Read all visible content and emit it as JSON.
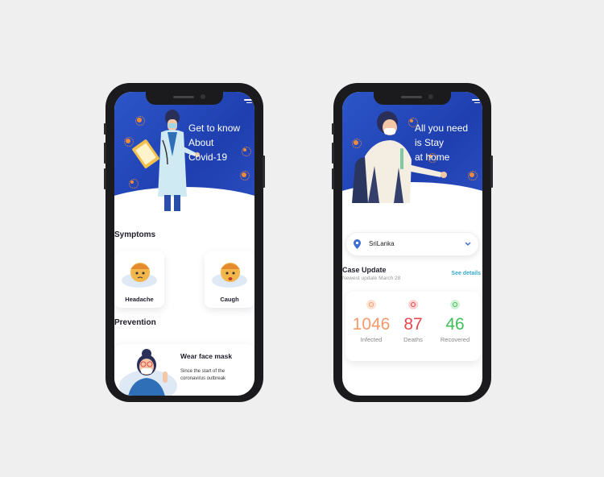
{
  "left_phone": {
    "hero_title": "Get to know\nAbout\nCovid-19",
    "symptoms_title": "Symptoms",
    "symptoms": [
      {
        "label": "Headache"
      },
      {
        "label": "Caugh"
      }
    ],
    "prevention_title": "Prevention",
    "prevention_card": {
      "title": "Wear face mask",
      "description": "Since the start of the coronavirus outbreak"
    }
  },
  "right_phone": {
    "hero_title": "All you need\nis Stay\nat home",
    "location": {
      "value": "SriLanka"
    },
    "case_update": {
      "title": "Case Update",
      "subtitle": "Newest update March 28",
      "see_details": "See details"
    },
    "stats": [
      {
        "value": "1046",
        "label": "Infected",
        "color": "#f39a6b"
      },
      {
        "value": "87",
        "label": "Deaths",
        "color": "#e5484d"
      },
      {
        "value": "46",
        "label": "Recovered",
        "color": "#3fbf5a"
      }
    ]
  },
  "colors": {
    "hero_blue": "#2348bd",
    "accent_teal": "#36a8c9",
    "virus_orange": "#f08a3a"
  },
  "icons": [
    "menu-icon",
    "location-pin-icon",
    "chevron-down-icon",
    "virus-icon",
    "status-dot-icon"
  ]
}
